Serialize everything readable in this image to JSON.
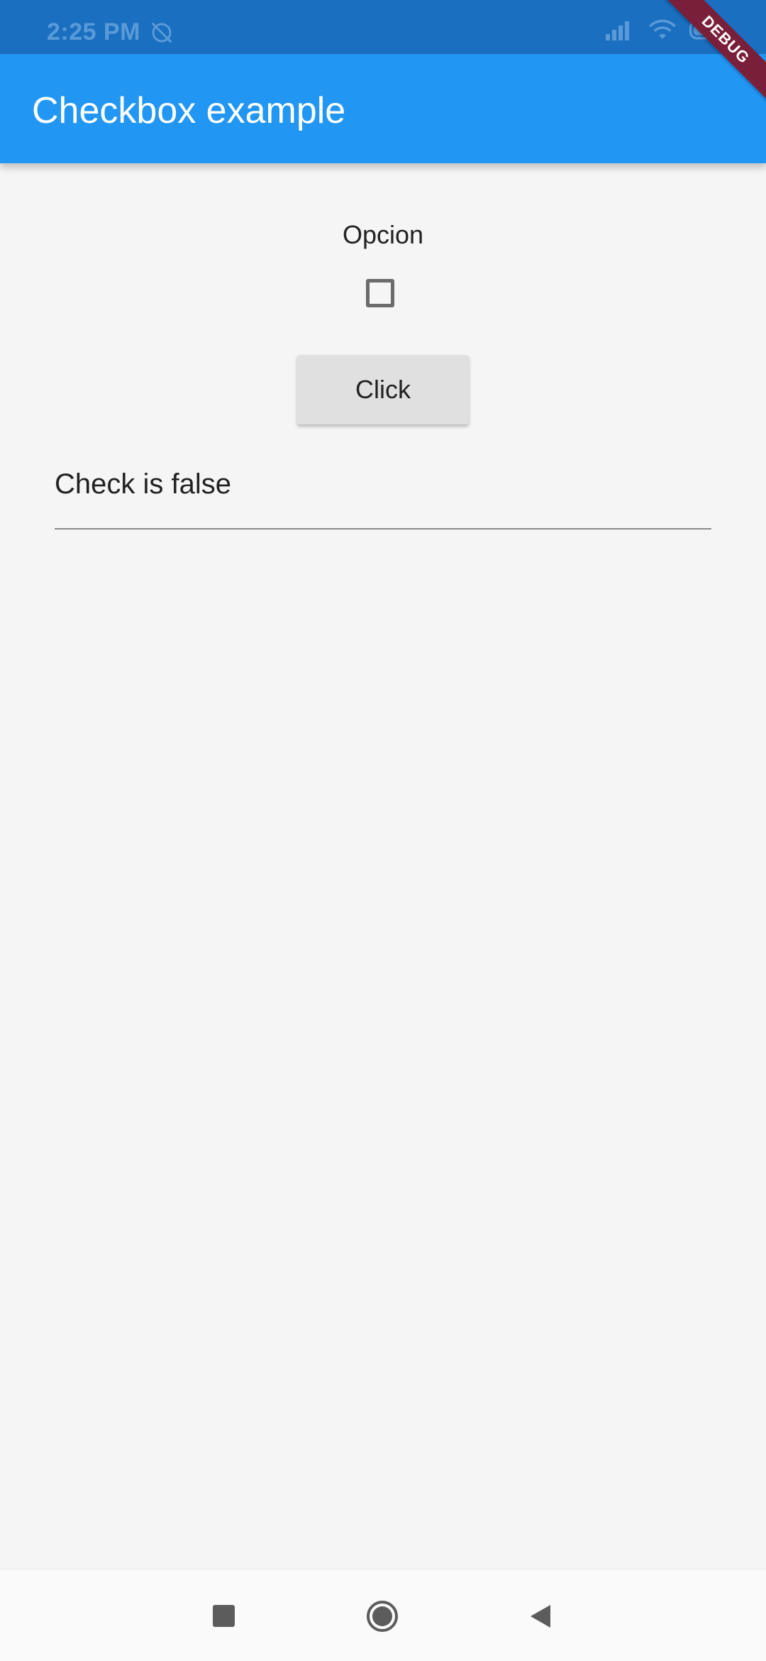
{
  "status_bar": {
    "time": "2:25 PM",
    "icons": [
      "alarm-off-icon",
      "signal-icon",
      "wifi-icon",
      "battery-icon"
    ]
  },
  "app_bar": {
    "title": "Checkbox example",
    "color": "#2196f3"
  },
  "debug_banner": {
    "label": "DEBUG"
  },
  "main": {
    "option_label": "Opcion",
    "checkbox_checked": false,
    "button_label": "Click",
    "text_field_value": "Check is false"
  },
  "nav_bar": {
    "icons": [
      "recents-icon",
      "home-icon",
      "back-icon"
    ]
  }
}
